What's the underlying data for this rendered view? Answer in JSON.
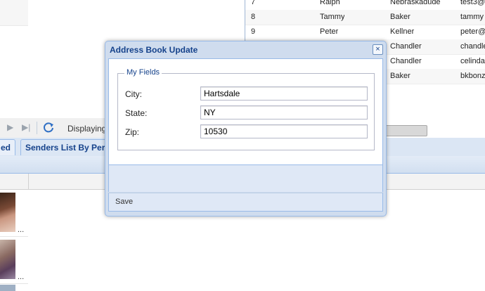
{
  "address_grid": {
    "rows": [
      {
        "id": "7",
        "first": "Ralph",
        "last": "Nebraskadude",
        "email": "test3@"
      },
      {
        "id": "8",
        "first": "Tammy",
        "last": "Baker",
        "email": "tammy"
      },
      {
        "id": "9",
        "first": "Peter",
        "last": "Kellner",
        "email": "peter@"
      },
      {
        "id": "",
        "first": "",
        "last": "Chandler",
        "email": "chandle"
      },
      {
        "id": "",
        "first": "",
        "last": "Chandler",
        "email": "celinda"
      },
      {
        "id": "",
        "first": "",
        "last": "Baker",
        "email": "bkbonz"
      }
    ]
  },
  "paging_toolbar": {
    "next_icon": "▶",
    "last_icon": "▶|",
    "refresh_icon": "refresh-icon",
    "displaying_label": "Displaying"
  },
  "tabs": {
    "items": [
      {
        "label": "ed"
      },
      {
        "label": "Senders List By Pers"
      }
    ]
  },
  "thumbnails": {
    "items": [
      {
        "ellipsis": "..."
      },
      {
        "ellipsis": "..."
      }
    ]
  },
  "dialog": {
    "title": "Address Book Update",
    "close_icon": "×",
    "fieldset_legend": "My Fields",
    "fields": [
      {
        "label": "City:",
        "value": "Hartsdale"
      },
      {
        "label": "State:",
        "value": "NY"
      },
      {
        "label": "Zip:",
        "value": "10530"
      }
    ],
    "save_label": "Save"
  },
  "colors": {
    "title_text": "#15428b",
    "panel_border": "#99bbe8",
    "panel_bg": "#dfe8f6"
  }
}
